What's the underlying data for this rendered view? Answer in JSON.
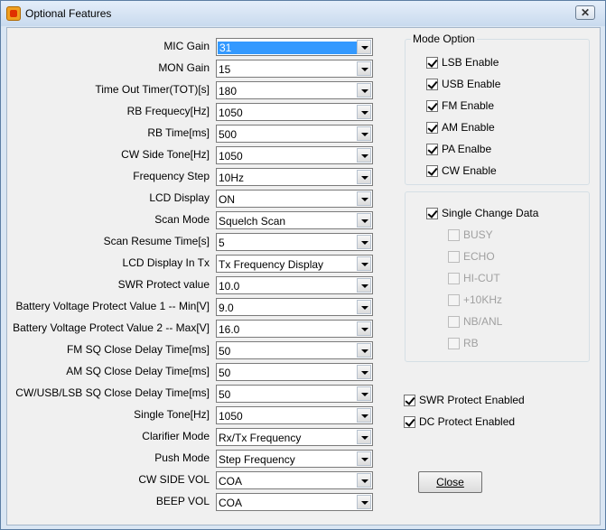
{
  "window": {
    "title": "Optional Features",
    "close_glyph": "✕"
  },
  "fields": [
    {
      "label": "MIC Gain",
      "value": "31",
      "selected": true
    },
    {
      "label": "MON Gain",
      "value": "15"
    },
    {
      "label": "Time Out Timer(TOT)[s]",
      "value": "180"
    },
    {
      "label": "RB Frequecy[Hz]",
      "value": "1050"
    },
    {
      "label": "RB Time[ms]",
      "value": "500"
    },
    {
      "label": "CW Side Tone[Hz]",
      "value": "1050"
    },
    {
      "label": "Frequency Step",
      "value": "10Hz"
    },
    {
      "label": "LCD Display",
      "value": "ON"
    },
    {
      "label": "Scan Mode",
      "value": "Squelch Scan"
    },
    {
      "label": "Scan Resume Time[s]",
      "value": "5"
    },
    {
      "label": "LCD Display In Tx",
      "value": "Tx Frequency Display"
    },
    {
      "label": "SWR Protect value",
      "value": "10.0"
    },
    {
      "label": "Battery Voltage Protect Value 1 -- Min[V]",
      "value": "9.0"
    },
    {
      "label": "Battery Voltage Protect Value 2 -- Max[V]",
      "value": "16.0"
    },
    {
      "label": "FM SQ Close Delay Time[ms]",
      "value": "50"
    },
    {
      "label": "AM SQ Close Delay Time[ms]",
      "value": "50"
    },
    {
      "label": "CW/USB/LSB SQ Close Delay Time[ms]",
      "value": "50"
    },
    {
      "label": "Single Tone[Hz]",
      "value": "1050"
    },
    {
      "label": "Clarifier Mode",
      "value": "Rx/Tx Frequency"
    },
    {
      "label": "Push Mode",
      "value": "Step Frequency"
    },
    {
      "label": "CW SIDE VOL",
      "value": "COA"
    },
    {
      "label": "BEEP VOL",
      "value": "COA"
    }
  ],
  "mode_option": {
    "title": "Mode Option",
    "items": [
      {
        "label": "LSB Enable",
        "checked": true
      },
      {
        "label": "USB Enable",
        "checked": true
      },
      {
        "label": "FM Enable",
        "checked": true
      },
      {
        "label": "AM Enable",
        "checked": true
      },
      {
        "label": "PA Enalbe",
        "checked": true
      },
      {
        "label": "CW Enable",
        "checked": true
      }
    ]
  },
  "single_change": {
    "label": "Single Change Data",
    "checked": true,
    "items": [
      {
        "label": "BUSY",
        "checked": false,
        "disabled": true
      },
      {
        "label": "ECHO",
        "checked": false,
        "disabled": true
      },
      {
        "label": "HI-CUT",
        "checked": false,
        "disabled": true
      },
      {
        "label": "+10KHz",
        "checked": false,
        "disabled": true
      },
      {
        "label": "NB/ANL",
        "checked": false,
        "disabled": true
      },
      {
        "label": "RB",
        "checked": false,
        "disabled": true
      }
    ]
  },
  "protect": [
    {
      "label": "SWR Protect Enabled",
      "checked": true
    },
    {
      "label": "DC Protect Enabled",
      "checked": true
    }
  ],
  "buttons": {
    "close": "Close"
  }
}
